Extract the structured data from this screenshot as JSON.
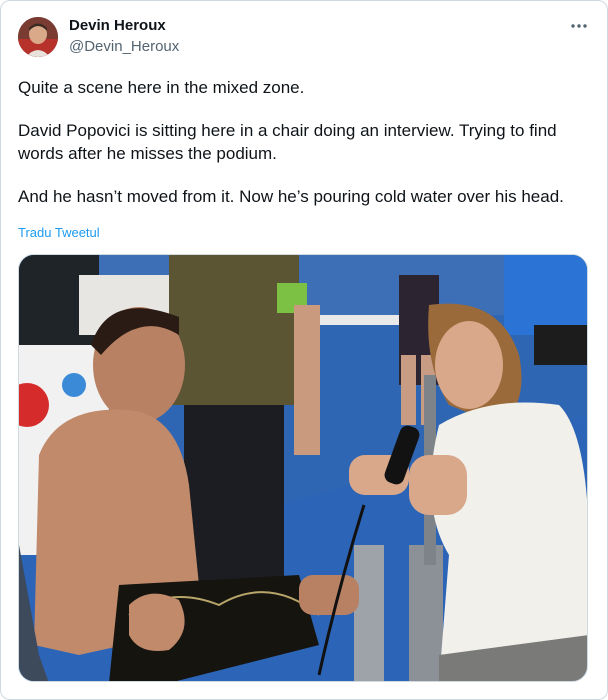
{
  "tweet": {
    "author_name": "Devin Heroux",
    "author_handle": "@Devin_Heroux",
    "more_icon": "more-horizontal-icon",
    "paragraphs": [
      "Quite a scene here in the mixed zone.",
      "David Popovici is sitting here in a chair doing an interview. Trying to find words after he misses the podium.",
      "And he hasn’t moved from it. Now he’s pouring cold water over his head."
    ],
    "translate_label": "Tradu Tweetul"
  },
  "colors": {
    "link": "#1d9bf0",
    "text": "#0f1419",
    "secondary": "#536471",
    "border": "#cfd9de",
    "pool_blue": "#2f66b3"
  }
}
